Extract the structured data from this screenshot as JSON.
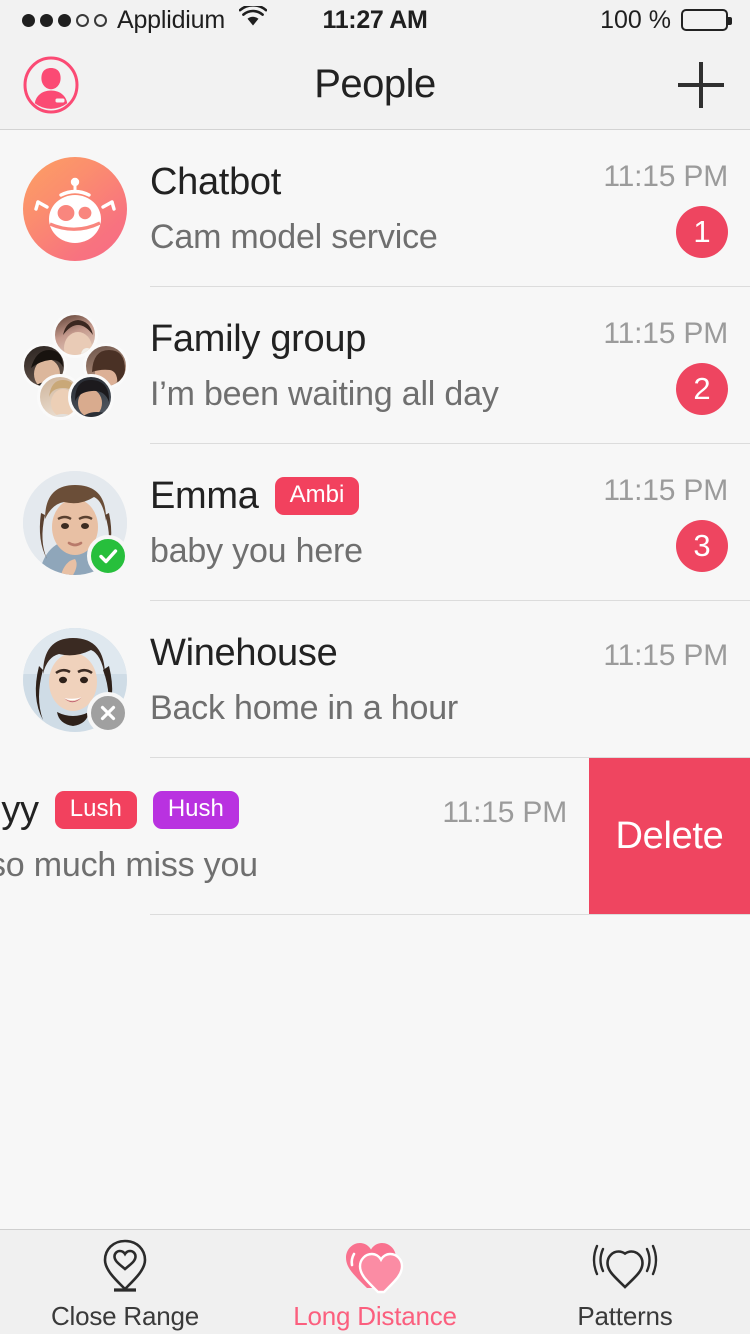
{
  "status_bar": {
    "carrier": "Applidium",
    "signal_filled": 3,
    "signal_total": 5,
    "wifi_icon": "wifi-icon",
    "time": "11:27 AM",
    "battery_percent": "100 %",
    "battery_level": 100
  },
  "nav": {
    "title": "People",
    "profile_icon": "profile-avatar-icon",
    "add_icon": "plus-icon"
  },
  "colors": {
    "accent_pink": "#fb5f7e",
    "badge_pink": "#ee4560",
    "tag_pink": "#f2415e",
    "tag_purple": "#b932e0",
    "online_green": "#27bf3c",
    "offline_gray": "#a0a0a0",
    "delete_red": "#ef4560",
    "background": "#f7f7f7",
    "bar_background": "#f2f2f2",
    "separator": "#dcdcdc",
    "title_text": "#222222",
    "preview_text": "#6f6f6f",
    "time_text": "#9b9b9b"
  },
  "conversations": [
    {
      "name": "Chatbot",
      "preview": "Cam model service",
      "time": "11:15 PM",
      "unread": "1",
      "tags": [],
      "avatar_type": "bot",
      "avatar_name": "chatbot-robot-avatar",
      "presence": null,
      "swiped": false
    },
    {
      "name": "Family group",
      "preview": "I’m been waiting all day",
      "time": "11:15 PM",
      "unread": "2",
      "tags": [],
      "avatar_type": "group",
      "avatar_name": "family-group-avatar-cluster",
      "presence": null,
      "swiped": false
    },
    {
      "name": "Emma",
      "preview": "baby you here",
      "time": "11:15 PM",
      "unread": "3",
      "tags": [
        {
          "label": "Ambi",
          "color": "#f2415e"
        }
      ],
      "avatar_type": "photo",
      "avatar_name": "emma-avatar",
      "presence": "online",
      "presence_icon": "check-circle-icon",
      "swiped": false
    },
    {
      "name": "Winehouse",
      "preview": "Back home in a hour",
      "time": "11:15 PM",
      "unread": "",
      "tags": [],
      "avatar_type": "photo",
      "avatar_name": "winehouse-avatar",
      "presence": "offline",
      "presence_icon": "x-circle-icon",
      "swiped": false
    },
    {
      "name": "-yy",
      "preview": "so much miss you",
      "time": "11:15 PM",
      "unread": "",
      "tags": [
        {
          "label": "Lush",
          "color": "#f2415e"
        },
        {
          "label": "Hush",
          "color": "#b932e0"
        }
      ],
      "avatar_type": "photo",
      "avatar_name": "lyy-avatar",
      "presence": null,
      "swiped": true,
      "delete_label": "Delete"
    }
  ],
  "tab_bar": {
    "tabs": [
      {
        "label": "Close Range",
        "icon": "map-pin-heart-icon",
        "active": false
      },
      {
        "label": "Long Distance",
        "icon": "double-heart-icon",
        "active": true
      },
      {
        "label": "Patterns",
        "icon": "heart-waves-icon",
        "active": false
      }
    ]
  }
}
